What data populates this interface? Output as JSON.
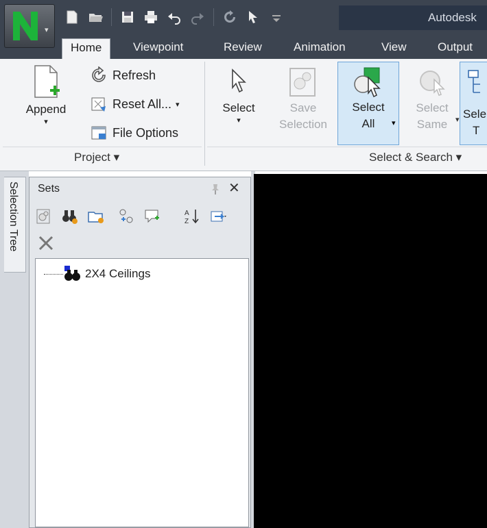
{
  "app": {
    "title_fragment": "Autodesk",
    "menu_arrow": "▾"
  },
  "tabs": [
    {
      "label": "Home",
      "active": true
    },
    {
      "label": "Viewpoint",
      "active": false
    },
    {
      "label": "Review",
      "active": false
    },
    {
      "label": "Animation",
      "active": false
    },
    {
      "label": "View",
      "active": false
    },
    {
      "label": "Output",
      "active": false
    }
  ],
  "ribbon": {
    "project": {
      "append_label": "Append",
      "refresh_label": "Refresh",
      "reset_all_label": "Reset All...",
      "file_options_label": "File Options",
      "group_label": "Project ▾"
    },
    "select_search": {
      "select_label": "Select",
      "save_selection_line1": "Save",
      "save_selection_line2": "Selection",
      "select_all_line1": "Select",
      "select_all_line2": "All",
      "select_same_line1": "Select",
      "select_same_line2": "Same",
      "select_tree_line1": "Sele",
      "select_tree_line2": "T",
      "group_label": "Select & Search ▾"
    }
  },
  "left_tab": {
    "label": "Selection Tree"
  },
  "sets_panel": {
    "title": "Sets",
    "close_glyph": "✕",
    "items": [
      {
        "label": "2X4 Ceilings"
      }
    ]
  },
  "colors": {
    "titlebar": "#3c4450",
    "ribbon": "#f3f4f6",
    "highlight": "#d5e8f7",
    "viewport": "#000000",
    "logo_green": "#1db33a"
  }
}
